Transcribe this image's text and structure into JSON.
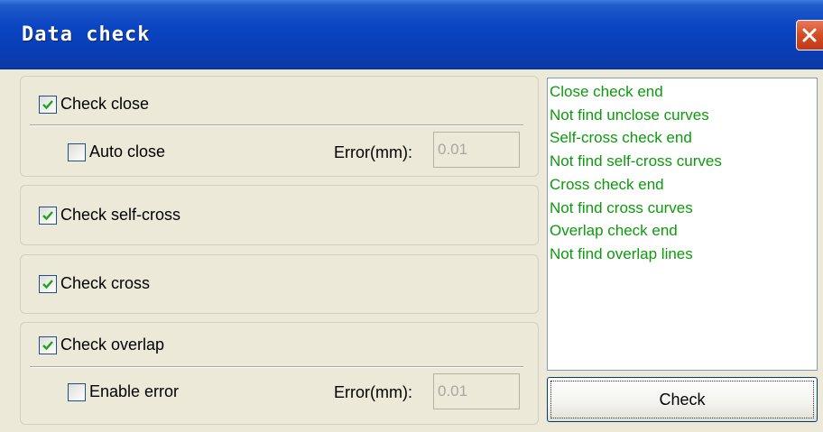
{
  "window": {
    "title": "Data check",
    "close_icon": "close-x-icon"
  },
  "close_group": {
    "check_close": {
      "label": "Check close",
      "checked": true
    },
    "auto_close": {
      "label": "Auto close",
      "checked": false
    },
    "error_label": "Error(mm):",
    "error_value": "0.01"
  },
  "self_cross_group": {
    "check_self_cross": {
      "label": "Check self-cross",
      "checked": true
    }
  },
  "cross_group": {
    "check_cross": {
      "label": "Check cross",
      "checked": true
    }
  },
  "overlap_group": {
    "check_overlap": {
      "label": "Check overlap",
      "checked": true
    },
    "enable_error": {
      "label": "Enable error",
      "checked": false
    },
    "error_label": "Error(mm):",
    "error_value": "0.01"
  },
  "log": {
    "lines": [
      "Close check end",
      "Not find unclose curves",
      "Self-cross check end",
      "Not find self-cross curves",
      "Cross check end",
      "Not find cross curves",
      "Overlap check end",
      "Not find overlap lines"
    ],
    "text_color": "#0c9a0c"
  },
  "check_button": {
    "label": "Check"
  },
  "colors": {
    "titlebar": "#0a44c2",
    "dialog_bg": "#ece9d8",
    "close_button": "#d24d24"
  }
}
